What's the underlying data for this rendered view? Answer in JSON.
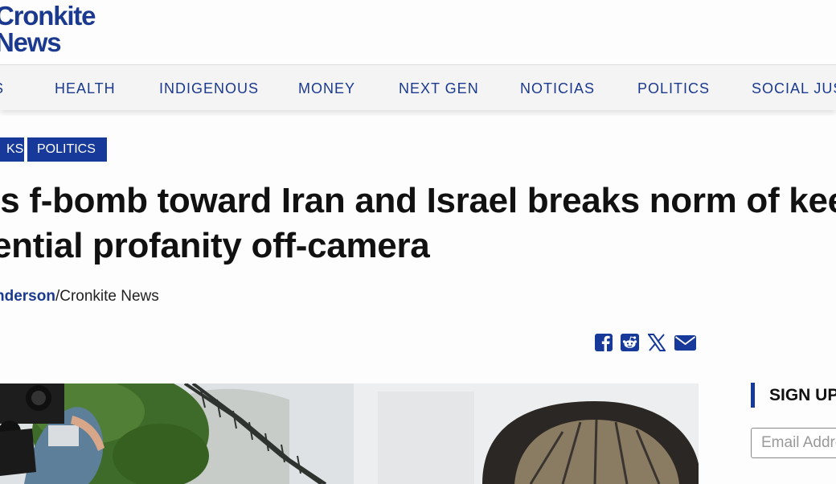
{
  "brand": {
    "line1": "Cronkite",
    "line2": "News",
    "color": "#1b3a8f"
  },
  "nav": {
    "items": [
      "S",
      "HEALTH",
      "INDIGENOUS",
      "MONEY",
      "NEXT GEN",
      "NOTICIAS",
      "POLITICS",
      "SOCIAL JUS"
    ]
  },
  "tags": [
    "KS",
    "POLITICS"
  ],
  "article": {
    "headline_line1": "’s f-bomb toward Iran and Israel breaks norm of kee",
    "headline_line2": "ential profanity off-camera",
    "byline_author": "nderson",
    "byline_source": "/Cronkite News"
  },
  "share": {
    "icons": [
      "facebook-icon",
      "reddit-icon",
      "x-icon",
      "email-icon"
    ]
  },
  "sidebar": {
    "signup_title": "SIGN UP",
    "email_placeholder": "Email Address"
  },
  "colors": {
    "accent": "#17399a",
    "nav_bg": "#f4f4f4"
  }
}
